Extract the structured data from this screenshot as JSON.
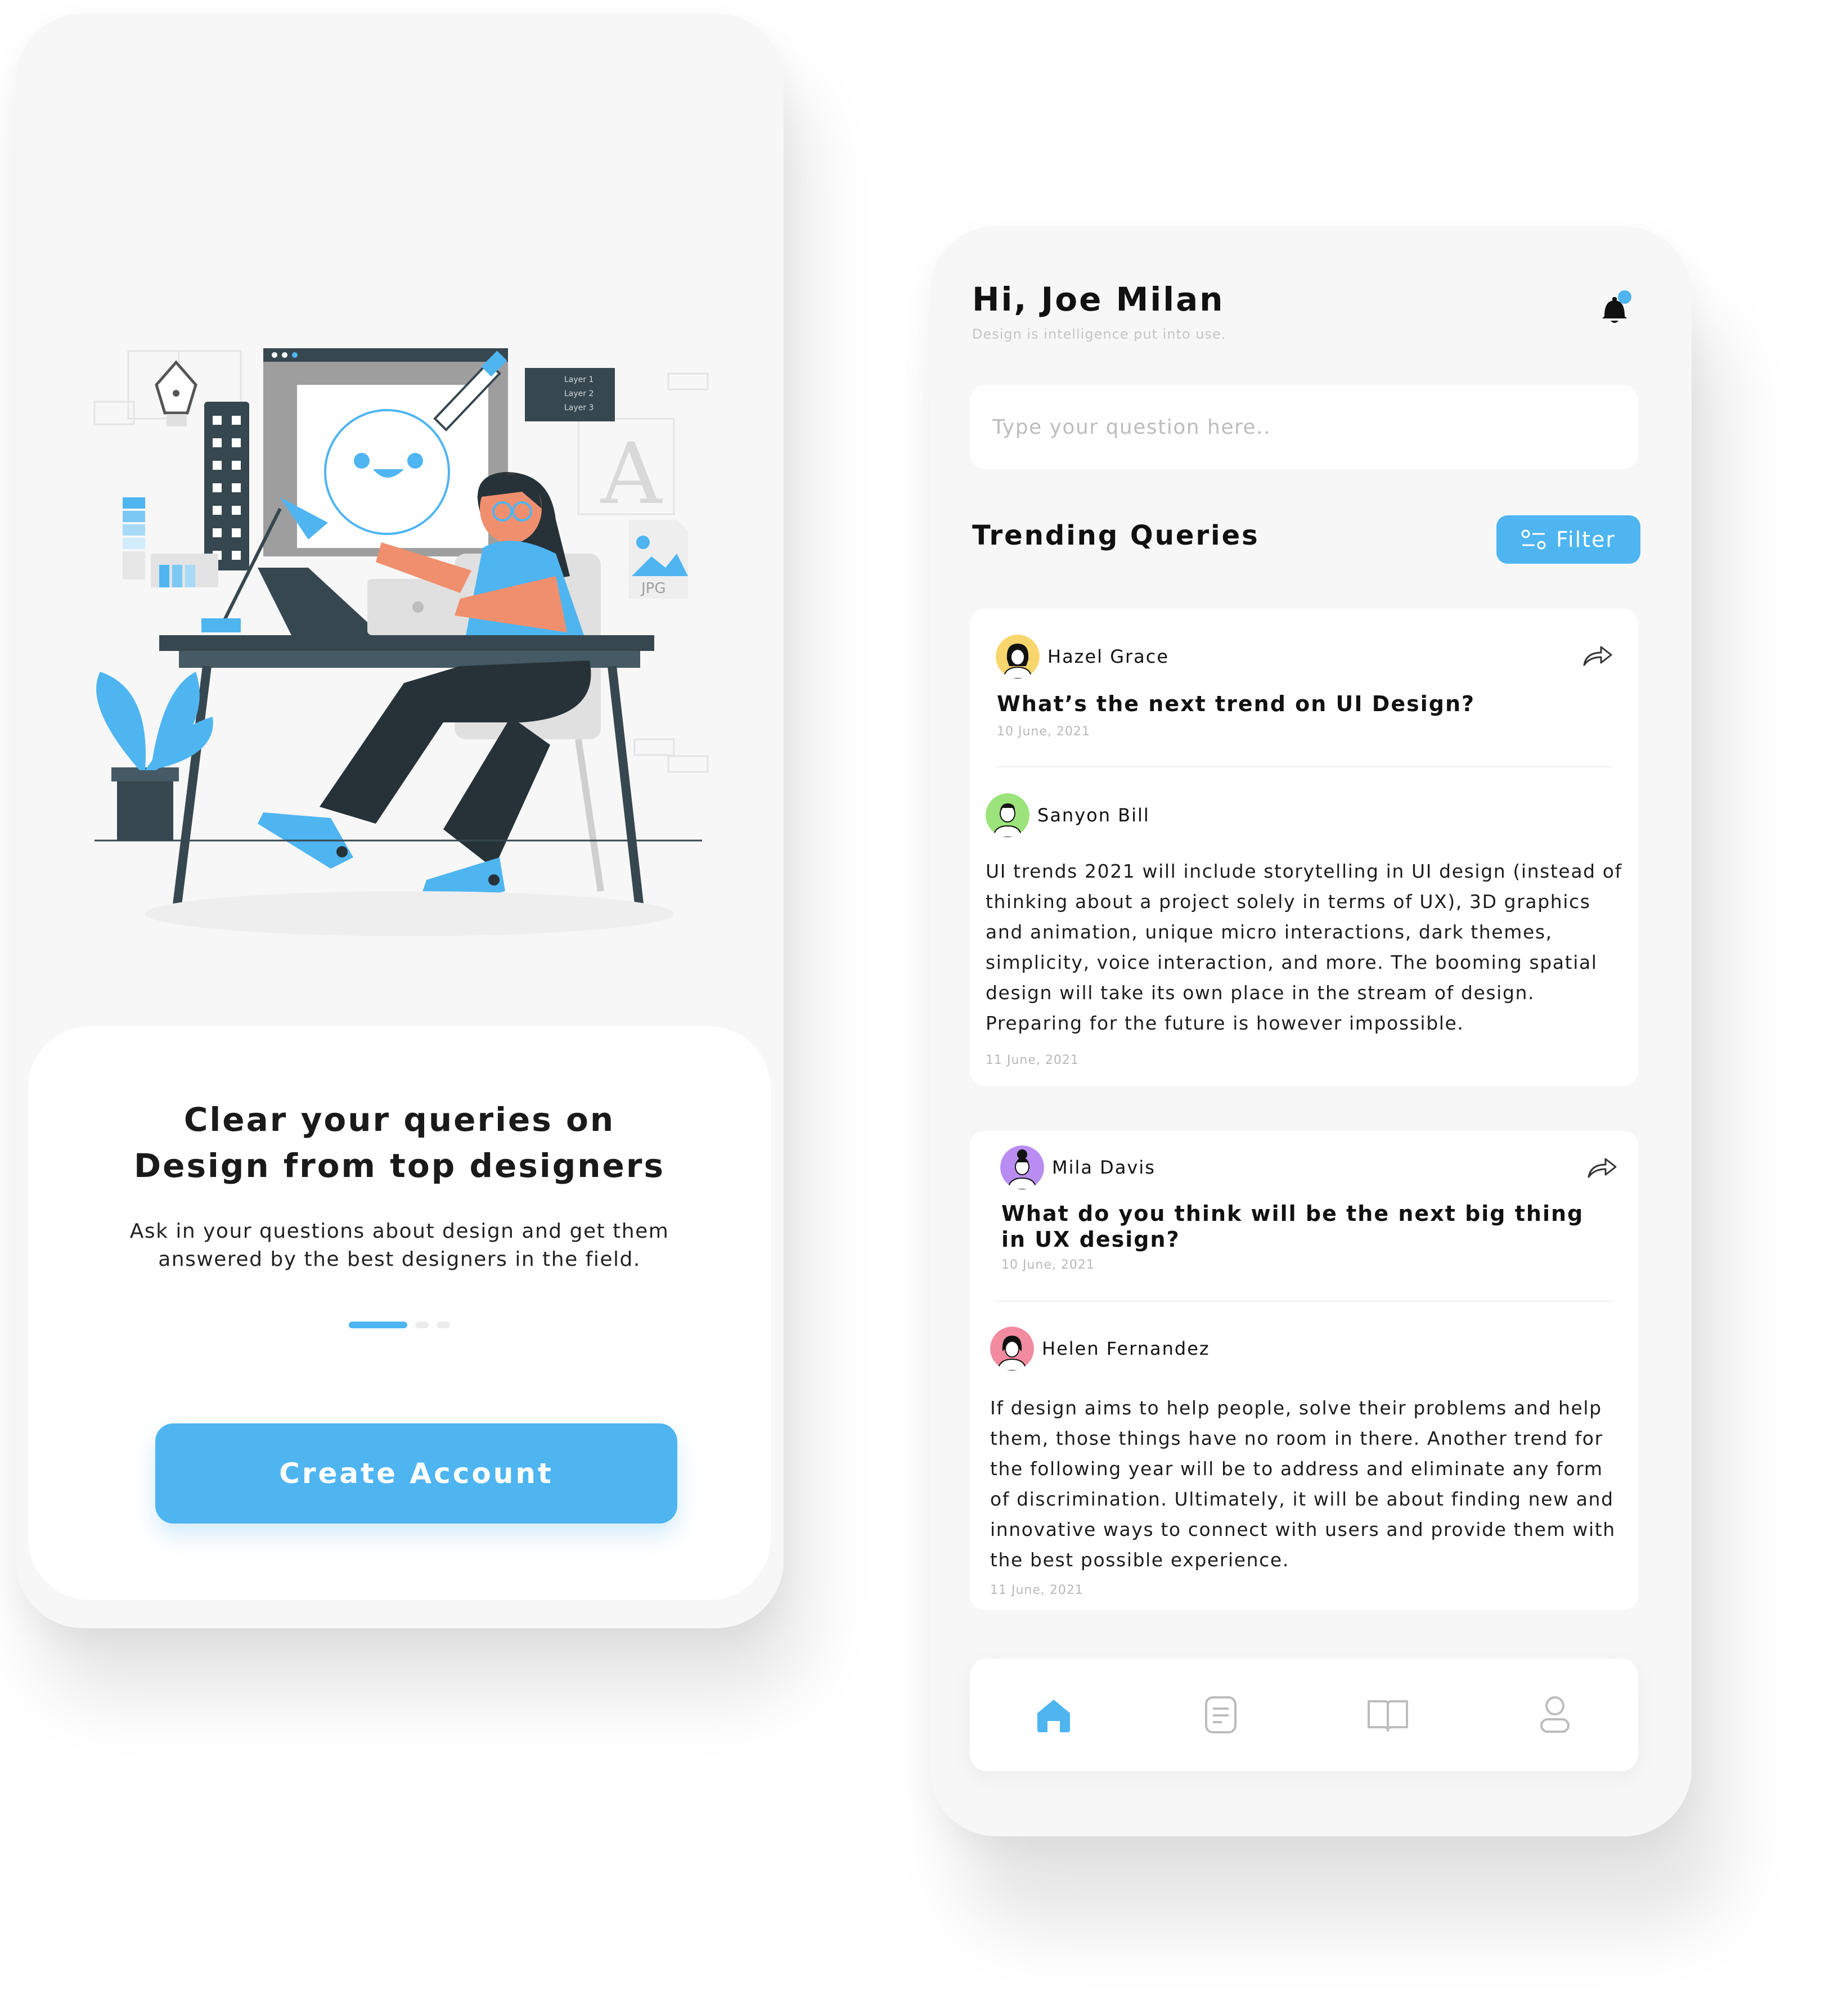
{
  "onboarding": {
    "illustration_labels": {
      "layer1": "Layer 1",
      "layer2": "Layer 2",
      "layer3": "Layer 3",
      "letter": "A",
      "file_type": "JPG"
    },
    "title_line1": "Clear your queries on",
    "title_line2": "Design from top designers",
    "body": "Ask in your questions about design and get them answered by the best designers in the field.",
    "create_account_label": "Create Account",
    "pager": {
      "pages": 3,
      "active": 1
    }
  },
  "home": {
    "greeting": "Hi, Joe Milan",
    "tagline": "Design is intelligence put into use.",
    "search_placeholder": "Type your question here..",
    "section_title": "Trending Queries",
    "filter_label": "Filter",
    "queries": [
      {
        "asker": "Hazel Grace",
        "question": "What’s the next trend on UI Design?",
        "date": "10 June, 2021",
        "answerer": "Sanyon Bill",
        "answer": "UI trends 2021 will include storytelling in UI design (instead of thinking about a project solely in terms of UX), 3D graphics and animation, unique micro interactions, dark themes, simplicity, voice interaction, and more. The booming spatial design will take its own place in the stream of design. Preparing for the future is however impossible.",
        "answer_date": "11 June, 2021"
      },
      {
        "asker": "Mila Davis",
        "question": "What do you think will be the next big thing in UX design?",
        "date": "10 June, 2021",
        "answerer": "Helen Fernandez",
        "answer": "If design aims to help people, solve their problems and help them, those things have no room in there. Another trend for the following year will be to address and eliminate any form of discrimination. Ultimately, it will be about finding new and innovative ways to connect with users and provide them with the best possible experience.",
        "answer_date": "11 June, 2021"
      }
    ],
    "nav": [
      "home-icon",
      "document-icon",
      "book-icon",
      "profile-icon"
    ]
  },
  "colors": {
    "accent": "#4eb5f1",
    "background": "#f7f7f7",
    "card": "#ffffff",
    "avatar_hazel": "#f8d66d",
    "avatar_sanyon": "#9be37a",
    "avatar_mila": "#b98cf2",
    "avatar_helen": "#f28ba0"
  }
}
